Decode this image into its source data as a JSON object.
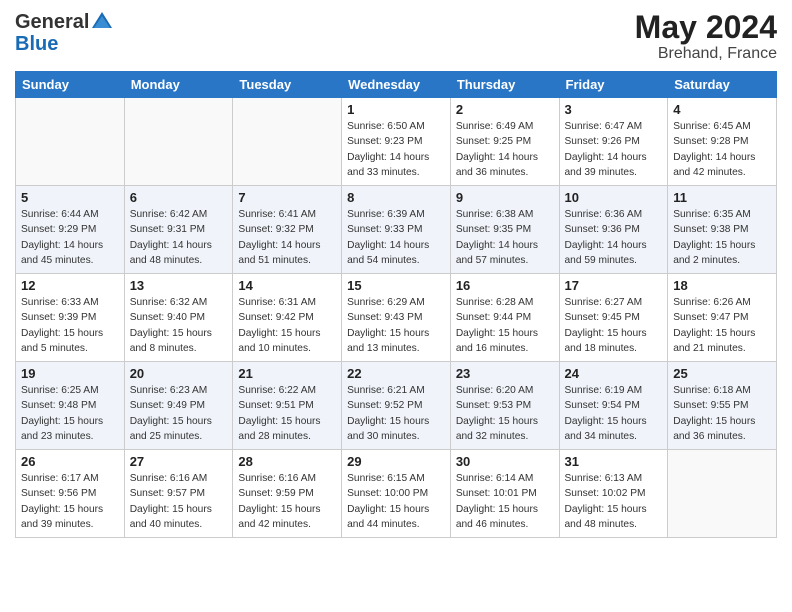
{
  "logo": {
    "general": "General",
    "blue": "Blue"
  },
  "title": {
    "month": "May 2024",
    "location": "Brehand, France"
  },
  "weekdays": [
    "Sunday",
    "Monday",
    "Tuesday",
    "Wednesday",
    "Thursday",
    "Friday",
    "Saturday"
  ],
  "weeks": [
    [
      {
        "day": "",
        "info": ""
      },
      {
        "day": "",
        "info": ""
      },
      {
        "day": "",
        "info": ""
      },
      {
        "day": "1",
        "info": "Sunrise: 6:50 AM\nSunset: 9:23 PM\nDaylight: 14 hours\nand 33 minutes."
      },
      {
        "day": "2",
        "info": "Sunrise: 6:49 AM\nSunset: 9:25 PM\nDaylight: 14 hours\nand 36 minutes."
      },
      {
        "day": "3",
        "info": "Sunrise: 6:47 AM\nSunset: 9:26 PM\nDaylight: 14 hours\nand 39 minutes."
      },
      {
        "day": "4",
        "info": "Sunrise: 6:45 AM\nSunset: 9:28 PM\nDaylight: 14 hours\nand 42 minutes."
      }
    ],
    [
      {
        "day": "5",
        "info": "Sunrise: 6:44 AM\nSunset: 9:29 PM\nDaylight: 14 hours\nand 45 minutes."
      },
      {
        "day": "6",
        "info": "Sunrise: 6:42 AM\nSunset: 9:31 PM\nDaylight: 14 hours\nand 48 minutes."
      },
      {
        "day": "7",
        "info": "Sunrise: 6:41 AM\nSunset: 9:32 PM\nDaylight: 14 hours\nand 51 minutes."
      },
      {
        "day": "8",
        "info": "Sunrise: 6:39 AM\nSunset: 9:33 PM\nDaylight: 14 hours\nand 54 minutes."
      },
      {
        "day": "9",
        "info": "Sunrise: 6:38 AM\nSunset: 9:35 PM\nDaylight: 14 hours\nand 57 minutes."
      },
      {
        "day": "10",
        "info": "Sunrise: 6:36 AM\nSunset: 9:36 PM\nDaylight: 14 hours\nand 59 minutes."
      },
      {
        "day": "11",
        "info": "Sunrise: 6:35 AM\nSunset: 9:38 PM\nDaylight: 15 hours\nand 2 minutes."
      }
    ],
    [
      {
        "day": "12",
        "info": "Sunrise: 6:33 AM\nSunset: 9:39 PM\nDaylight: 15 hours\nand 5 minutes."
      },
      {
        "day": "13",
        "info": "Sunrise: 6:32 AM\nSunset: 9:40 PM\nDaylight: 15 hours\nand 8 minutes."
      },
      {
        "day": "14",
        "info": "Sunrise: 6:31 AM\nSunset: 9:42 PM\nDaylight: 15 hours\nand 10 minutes."
      },
      {
        "day": "15",
        "info": "Sunrise: 6:29 AM\nSunset: 9:43 PM\nDaylight: 15 hours\nand 13 minutes."
      },
      {
        "day": "16",
        "info": "Sunrise: 6:28 AM\nSunset: 9:44 PM\nDaylight: 15 hours\nand 16 minutes."
      },
      {
        "day": "17",
        "info": "Sunrise: 6:27 AM\nSunset: 9:45 PM\nDaylight: 15 hours\nand 18 minutes."
      },
      {
        "day": "18",
        "info": "Sunrise: 6:26 AM\nSunset: 9:47 PM\nDaylight: 15 hours\nand 21 minutes."
      }
    ],
    [
      {
        "day": "19",
        "info": "Sunrise: 6:25 AM\nSunset: 9:48 PM\nDaylight: 15 hours\nand 23 minutes."
      },
      {
        "day": "20",
        "info": "Sunrise: 6:23 AM\nSunset: 9:49 PM\nDaylight: 15 hours\nand 25 minutes."
      },
      {
        "day": "21",
        "info": "Sunrise: 6:22 AM\nSunset: 9:51 PM\nDaylight: 15 hours\nand 28 minutes."
      },
      {
        "day": "22",
        "info": "Sunrise: 6:21 AM\nSunset: 9:52 PM\nDaylight: 15 hours\nand 30 minutes."
      },
      {
        "day": "23",
        "info": "Sunrise: 6:20 AM\nSunset: 9:53 PM\nDaylight: 15 hours\nand 32 minutes."
      },
      {
        "day": "24",
        "info": "Sunrise: 6:19 AM\nSunset: 9:54 PM\nDaylight: 15 hours\nand 34 minutes."
      },
      {
        "day": "25",
        "info": "Sunrise: 6:18 AM\nSunset: 9:55 PM\nDaylight: 15 hours\nand 36 minutes."
      }
    ],
    [
      {
        "day": "26",
        "info": "Sunrise: 6:17 AM\nSunset: 9:56 PM\nDaylight: 15 hours\nand 39 minutes."
      },
      {
        "day": "27",
        "info": "Sunrise: 6:16 AM\nSunset: 9:57 PM\nDaylight: 15 hours\nand 40 minutes."
      },
      {
        "day": "28",
        "info": "Sunrise: 6:16 AM\nSunset: 9:59 PM\nDaylight: 15 hours\nand 42 minutes."
      },
      {
        "day": "29",
        "info": "Sunrise: 6:15 AM\nSunset: 10:00 PM\nDaylight: 15 hours\nand 44 minutes."
      },
      {
        "day": "30",
        "info": "Sunrise: 6:14 AM\nSunset: 10:01 PM\nDaylight: 15 hours\nand 46 minutes."
      },
      {
        "day": "31",
        "info": "Sunrise: 6:13 AM\nSunset: 10:02 PM\nDaylight: 15 hours\nand 48 minutes."
      },
      {
        "day": "",
        "info": ""
      }
    ]
  ]
}
